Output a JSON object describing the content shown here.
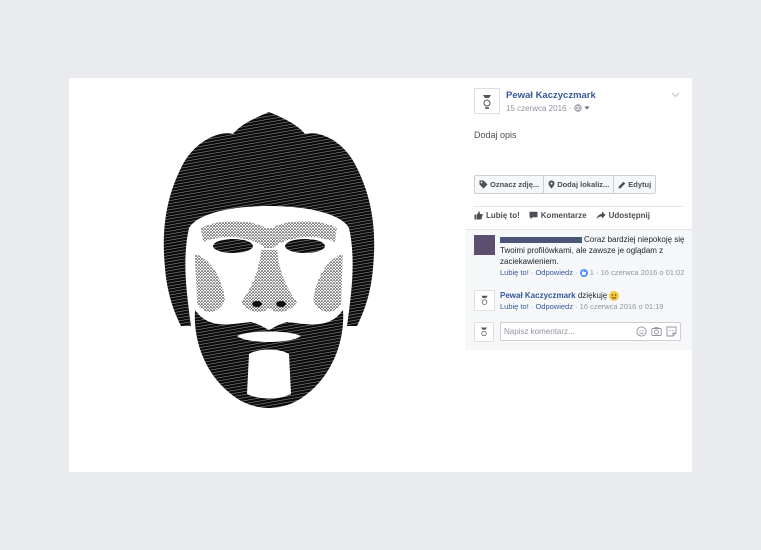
{
  "post": {
    "author": "Pewał Kaczyczmark",
    "date": "15 czerwca 2016",
    "separator": "·",
    "audience_icon": "globe-icon",
    "description_link": "Dodaj opis"
  },
  "photo_tools": {
    "tag": "Oznacz zdję...",
    "location": "Dodaj lokaliz...",
    "edit": "Edytuj"
  },
  "actions": {
    "like": "Lubię to!",
    "comment": "Komentarze",
    "share": "Udostępnij"
  },
  "comments": [
    {
      "author_redacted": true,
      "text": "Coraz bardziej niepokoję się Twoimi profilówkami, ale zawsze je oglądam z zaciekawieniem.",
      "like_link": "Lubię to!",
      "reply_link": "Odpowiedz",
      "like_count": "1",
      "timestamp": "16 czerwca 2016 o 01:02"
    },
    {
      "author": "Pewał Kaczyczmark",
      "text": "dziękuję",
      "emoji": "smiley-icon",
      "like_link": "Lubię to!",
      "reply_link": "Odpowiedz",
      "timestamp": "16 czerwca 2016 o 01:19"
    }
  ],
  "composer": {
    "placeholder": "Napisz komentarz..."
  },
  "colors": {
    "link": "#365899",
    "background": "#e9ebee",
    "comments_bg": "#f6f7f9",
    "redaction": "#4b5576",
    "commenter_avatar": "#5d4d6e"
  }
}
